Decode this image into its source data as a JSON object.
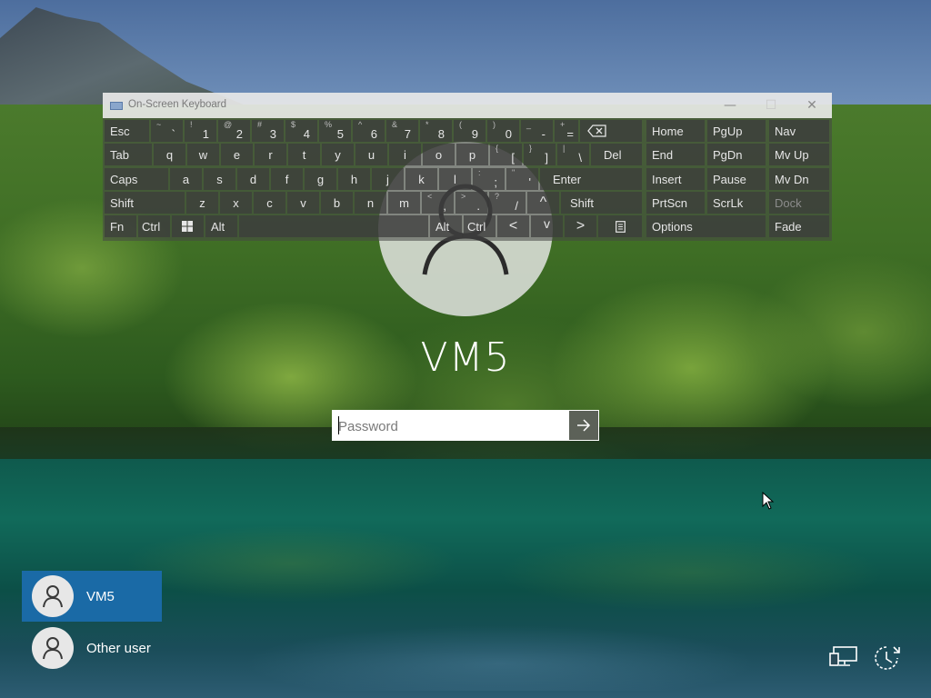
{
  "user": {
    "name": "VM5"
  },
  "password": {
    "placeholder": "Password"
  },
  "users": [
    {
      "name": "VM5",
      "selected": true
    },
    {
      "name": "Other user",
      "selected": false
    }
  ],
  "osk": {
    "title": "On-Screen Keyboard",
    "window_buttons": {
      "minimize": "—",
      "maximize": "☐",
      "close": "✕"
    },
    "keys": {
      "esc": "Esc",
      "backtick": {
        "top": "~",
        "bottom": "`"
      },
      "d1": {
        "top": "!",
        "bottom": "1"
      },
      "d2": {
        "top": "@",
        "bottom": "2"
      },
      "d3": {
        "top": "#",
        "bottom": "3"
      },
      "d4": {
        "top": "$",
        "bottom": "4"
      },
      "d5": {
        "top": "%",
        "bottom": "5"
      },
      "d6": {
        "top": "^",
        "bottom": "6"
      },
      "d7": {
        "top": "&",
        "bottom": "7"
      },
      "d8": {
        "top": "*",
        "bottom": "8"
      },
      "d9": {
        "top": "(",
        "bottom": "9"
      },
      "d0": {
        "top": ")",
        "bottom": "0"
      },
      "minus": {
        "top": "_",
        "bottom": "-"
      },
      "equals": {
        "top": "+",
        "bottom": "="
      },
      "tab": "Tab",
      "q": "q",
      "w": "w",
      "e": "e",
      "r": "r",
      "t": "t",
      "y": "y",
      "u": "u",
      "i": "i",
      "o": "o",
      "p": "p",
      "lbracket": {
        "top": "{",
        "bottom": "["
      },
      "rbracket": {
        "top": "}",
        "bottom": "]"
      },
      "backslash": {
        "top": "|",
        "bottom": "\\"
      },
      "del": "Del",
      "caps": "Caps",
      "a": "a",
      "s": "s",
      "d": "d",
      "f": "f",
      "g": "g",
      "h": "h",
      "j": "j",
      "k": "k",
      "l": "l",
      "semicolon": {
        "top": ":",
        "bottom": ";"
      },
      "quote": {
        "top": "\"",
        "bottom": "'"
      },
      "enter": "Enter",
      "shift": "Shift",
      "z": "z",
      "x": "x",
      "c": "c",
      "v": "v",
      "b": "b",
      "n": "n",
      "m": "m",
      "comma": {
        "top": "<",
        "bottom": ","
      },
      "period": {
        "top": ">",
        "bottom": "."
      },
      "slash": {
        "top": "?",
        "bottom": "/"
      },
      "up": "^",
      "fn": "Fn",
      "ctrl": "Ctrl",
      "alt": "Alt",
      "left": "<",
      "down": "v",
      "right": ">",
      "home": "Home",
      "pgup": "PgUp",
      "nav": "Nav",
      "end": "End",
      "pgdn": "PgDn",
      "mvup": "Mv Up",
      "insert": "Insert",
      "pause": "Pause",
      "mvdn": "Mv Dn",
      "prtscn": "PrtScn",
      "scrlk": "ScrLk",
      "dock": "Dock",
      "options": "Options",
      "fade": "Fade"
    }
  },
  "icons": {
    "backspace": "backspace-icon",
    "windows": "windows-logo-icon",
    "menu": "context-menu-icon",
    "submit": "arrow-right-icon",
    "network": "network-icon",
    "power": "power-icon",
    "accessibility": "ease-of-access-icon",
    "user": "user-icon"
  }
}
